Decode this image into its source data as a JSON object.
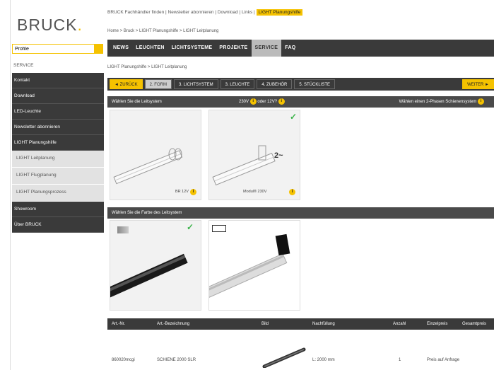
{
  "header": {
    "logo_text": "BRUCK",
    "logo_dot": ".",
    "toplinks": "BRUCK Fachhändler finden | Newsletter abonnieren | Download | Links |",
    "toplinks_highlight": "LIGHT Planungshilfe",
    "breadcrumb": "Home > Bruck > LIGHT Planungshilfe > LIGHT Leitplanung"
  },
  "search": {
    "value": "Profile"
  },
  "nav": {
    "items": [
      {
        "label": "NEWS"
      },
      {
        "label": "LEUCHTEN"
      },
      {
        "label": "LICHTSYSTEME"
      },
      {
        "label": "PROJEKTE"
      },
      {
        "label": "SERVICE"
      },
      {
        "label": "FAQ"
      }
    ]
  },
  "sidebar": {
    "title": "SERVICE",
    "items": [
      {
        "label": "Kontakt"
      },
      {
        "label": "Download"
      },
      {
        "label": "LED-Leuchte"
      },
      {
        "label": "Newsletter abonnieren"
      },
      {
        "label": "LIGHT Planungshilfe"
      }
    ],
    "subitems": [
      {
        "label": "LIGHT Leitplanung"
      },
      {
        "label": "LIGHT Flugplanung"
      },
      {
        "label": "LIGHT Planungsprozess"
      }
    ],
    "items_after": [
      {
        "label": "Showroom"
      },
      {
        "label": "Über BRUCK"
      }
    ]
  },
  "main": {
    "breadcrumb": "LIGHT Planungshilfe > LIGHT Leitplanung",
    "steps": {
      "back": "◄ ZURÜCK",
      "list": [
        "2. FORM",
        "3. LICHTSYSTEM",
        "3. LEUCHTE",
        "4. ZUBEHÖR",
        "5. STÜCKLISTE"
      ],
      "next": "WEITER ►"
    },
    "section1": {
      "title": "Wählen Sie die Leitsystem",
      "mid": "230V",
      "mid2": "oder 12V?",
      "right": "Wählen einen 2-Phasen Schienensystem"
    },
    "cards1": [
      {
        "caption": "BR 12V"
      },
      {
        "caption": "Modul® 230V"
      }
    ],
    "card_mark": "2~",
    "section2": {
      "title": "Wählen Sie die Farbe des Leitsystem"
    },
    "table": {
      "headers": [
        "Art.-Nr.",
        "Art.-Bezeichnung",
        "Bild",
        "Nachfüllung",
        "Anzahl",
        "Einzelpreis",
        "Gesamtpreis"
      ],
      "row": {
        "art_nr": "860020mcgi",
        "name": "SCHIENE 2000 SLR",
        "length": "L: 2000 mm",
        "qty": "1",
        "price": "Preis auf Anfrage"
      }
    }
  },
  "colors": {
    "accent": "#f5c200",
    "dark": "#3a3a3a",
    "check": "#3bb34a"
  }
}
